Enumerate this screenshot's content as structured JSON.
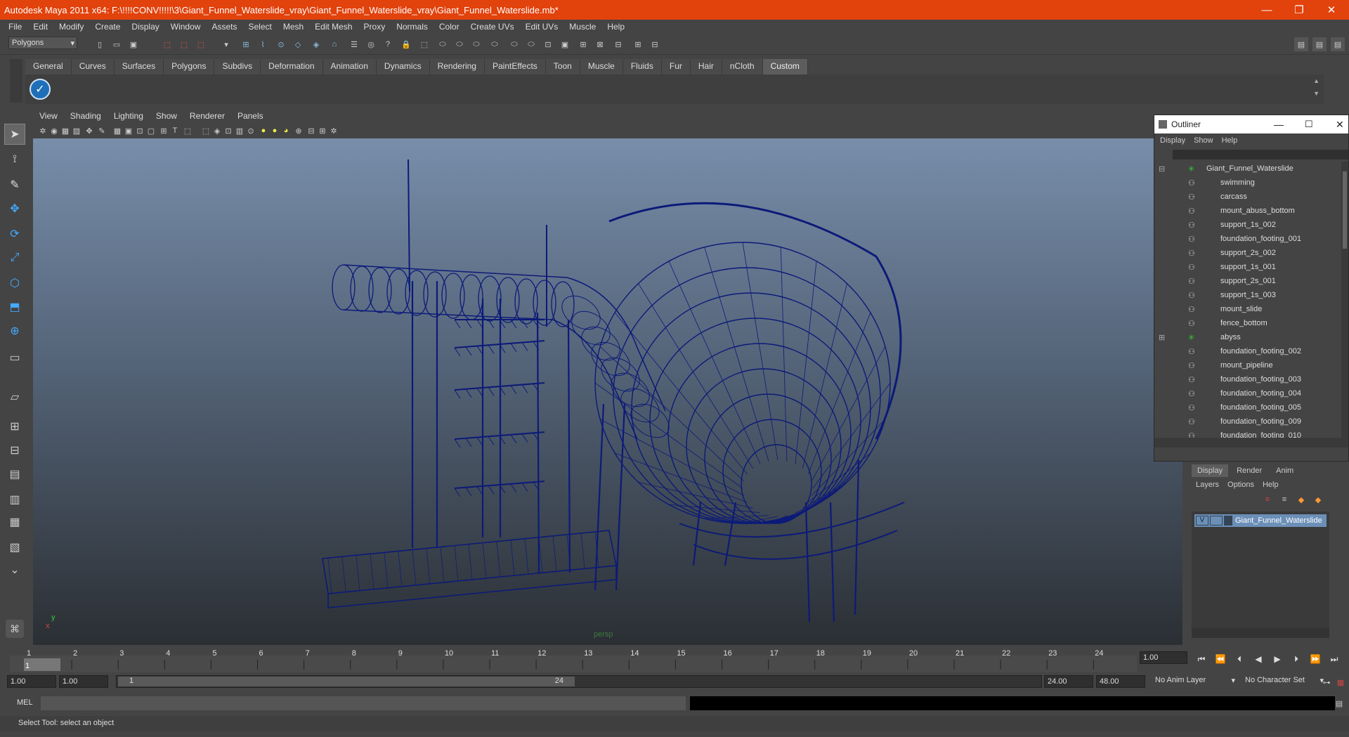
{
  "window": {
    "title": "Autodesk Maya 2011 x64: F:\\!!!!CONV!!!!!\\3\\Giant_Funnel_Waterslide_vray\\Giant_Funnel_Waterslide_vray\\Giant_Funnel_Waterslide.mb*",
    "minimize": "—",
    "restore": "❐",
    "close": "✕"
  },
  "menu": [
    "File",
    "Edit",
    "Modify",
    "Create",
    "Display",
    "Window",
    "Assets",
    "Select",
    "Mesh",
    "Edit Mesh",
    "Proxy",
    "Normals",
    "Color",
    "Create UVs",
    "Edit UVs",
    "Muscle",
    "Help"
  ],
  "mode_selector": "Polygons",
  "shelf_tabs": [
    "General",
    "Curves",
    "Surfaces",
    "Polygons",
    "Subdivs",
    "Deformation",
    "Animation",
    "Dynamics",
    "Rendering",
    "PaintEffects",
    "Toon",
    "Muscle",
    "Fluids",
    "Fur",
    "Hair",
    "nCloth",
    "Custom"
  ],
  "active_shelf": "Custom",
  "viewport": {
    "menu": [
      "View",
      "Shading",
      "Lighting",
      "Show",
      "Renderer",
      "Panels"
    ],
    "camera_label": "persp",
    "axis_y": "y",
    "axis_x": "x",
    "wire_color": "#0c1a78"
  },
  "outliner": {
    "title": "Outliner",
    "menu": [
      "Display",
      "Show",
      "Help"
    ],
    "items": [
      "Giant_Funnel_Waterslide",
      "swimming",
      "carcass",
      "mount_abuss_bottom",
      "support_1s_002",
      "foundation_footing_001",
      "support_2s_002",
      "support_1s_001",
      "support_2s_001",
      "support_1s_003",
      "mount_slide",
      "fence_bottom",
      "abyss",
      "foundation_footing_002",
      "mount_pipeline",
      "foundation_footing_003",
      "foundation_footing_004",
      "foundation_footing_005",
      "foundation_footing_009",
      "foundation_footing_010"
    ]
  },
  "layers": {
    "tabs": [
      "Display",
      "Render",
      "Anim"
    ],
    "menu": [
      "Layers",
      "Options",
      "Help"
    ],
    "layer_name": "Giant_Funnel_Waterslide",
    "visible_flag": "V"
  },
  "time": {
    "ticks": [
      "1",
      "2",
      "3",
      "4",
      "5",
      "6",
      "7",
      "8",
      "9",
      "10",
      "11",
      "12",
      "13",
      "14",
      "15",
      "16",
      "17",
      "18",
      "19",
      "20",
      "21",
      "22",
      "23",
      "24"
    ],
    "current_frame": "1.00",
    "start": "1.00",
    "start2": "1.00",
    "range_start": "1",
    "range_end": "24",
    "end": "24.00",
    "end2": "48.00",
    "anim_layer": "No Anim Layer",
    "char_set": "No Character Set"
  },
  "command": {
    "label": "MEL"
  },
  "help_line": "Select Tool: select an object"
}
